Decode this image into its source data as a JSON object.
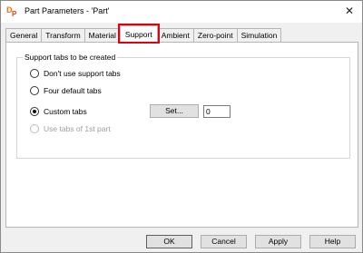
{
  "window": {
    "title": "Part Parameters - 'Part'",
    "app_icon": "dp-app-icon",
    "close_glyph": "✕"
  },
  "tabs": [
    {
      "label": "General",
      "active": false
    },
    {
      "label": "Transform",
      "active": false
    },
    {
      "label": "Material",
      "active": false
    },
    {
      "label": "Support",
      "active": true
    },
    {
      "label": "Ambient",
      "active": false
    },
    {
      "label": "Zero-point",
      "active": false
    },
    {
      "label": "Simulation",
      "active": false
    }
  ],
  "support": {
    "group_title": "Support tabs to be created",
    "options": [
      {
        "label": "Don't use support tabs",
        "checked": false,
        "enabled": true
      },
      {
        "label": "Four default tabs",
        "checked": false,
        "enabled": true
      },
      {
        "label": "Custom tabs",
        "checked": true,
        "enabled": true
      },
      {
        "label": "Use tabs of 1st part",
        "checked": false,
        "enabled": false
      }
    ],
    "set_button_label": "Set...",
    "custom_tab_count": "0"
  },
  "buttons": {
    "ok": "OK",
    "cancel": "Cancel",
    "apply": "Apply",
    "help": "Help"
  },
  "colors": {
    "highlight": "#e0000f",
    "icon_orange": "#e8741c"
  }
}
